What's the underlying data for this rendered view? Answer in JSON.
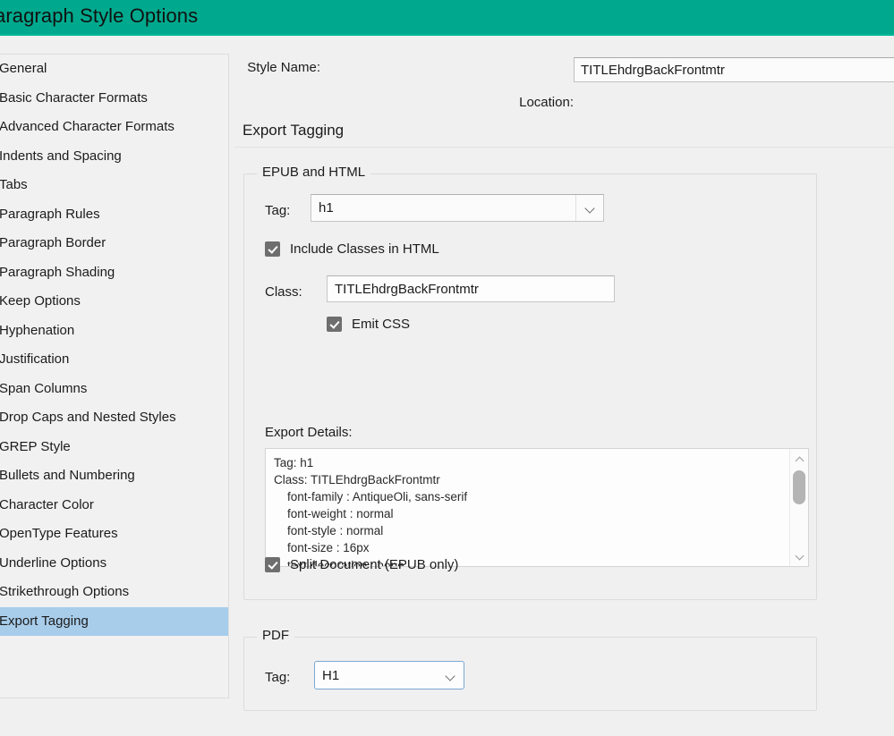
{
  "window": {
    "title": "aragraph Style Options",
    "accent_color": "#00a98d"
  },
  "sidebar": {
    "items": [
      {
        "label": "General",
        "selected": false
      },
      {
        "label": "Basic Character Formats",
        "selected": false
      },
      {
        "label": "Advanced Character Formats",
        "selected": false
      },
      {
        "label": "Indents and Spacing",
        "selected": false
      },
      {
        "label": "Tabs",
        "selected": false
      },
      {
        "label": "Paragraph Rules",
        "selected": false
      },
      {
        "label": "Paragraph Border",
        "selected": false
      },
      {
        "label": "Paragraph Shading",
        "selected": false
      },
      {
        "label": "Keep Options",
        "selected": false
      },
      {
        "label": "Hyphenation",
        "selected": false
      },
      {
        "label": "Justification",
        "selected": false
      },
      {
        "label": "Span Columns",
        "selected": false
      },
      {
        "label": "Drop Caps and Nested Styles",
        "selected": false
      },
      {
        "label": "GREP Style",
        "selected": false
      },
      {
        "label": "Bullets and Numbering",
        "selected": false
      },
      {
        "label": "Character Color",
        "selected": false
      },
      {
        "label": "OpenType Features",
        "selected": false
      },
      {
        "label": "Underline Options",
        "selected": false
      },
      {
        "label": "Strikethrough Options",
        "selected": false
      },
      {
        "label": "Export Tagging",
        "selected": true
      }
    ],
    "selected_color": "#a8cdeb"
  },
  "header": {
    "style_name_label": "Style Name:",
    "style_name_value": "TITLEhdrgBackFrontmtr",
    "location_label": "Location:",
    "location_value": ""
  },
  "main": {
    "section_heading": "Export Tagging",
    "epub_group": {
      "legend": "EPUB and HTML",
      "tag_label": "Tag:",
      "tag_value": "h1",
      "include_classes_label": "Include Classes in HTML",
      "include_classes_checked": true,
      "class_label": "Class:",
      "class_value": "TITLEhdrgBackFrontmtr",
      "emit_css_label": "Emit CSS",
      "emit_css_checked": true,
      "export_details_label": "Export Details:",
      "export_details_text": "Tag: h1\nClass: TITLEhdrgBackFrontmtr\n    font-family : AntiqueOli, sans-serif\n    font-weight : normal\n    font-style : normal\n    font-size : 16px\n    text-decoration : none",
      "split_document_label": "Split Document (EPUB only)",
      "split_document_checked": true
    },
    "pdf_group": {
      "legend": "PDF",
      "tag_label": "Tag:",
      "tag_value": "H1"
    }
  }
}
